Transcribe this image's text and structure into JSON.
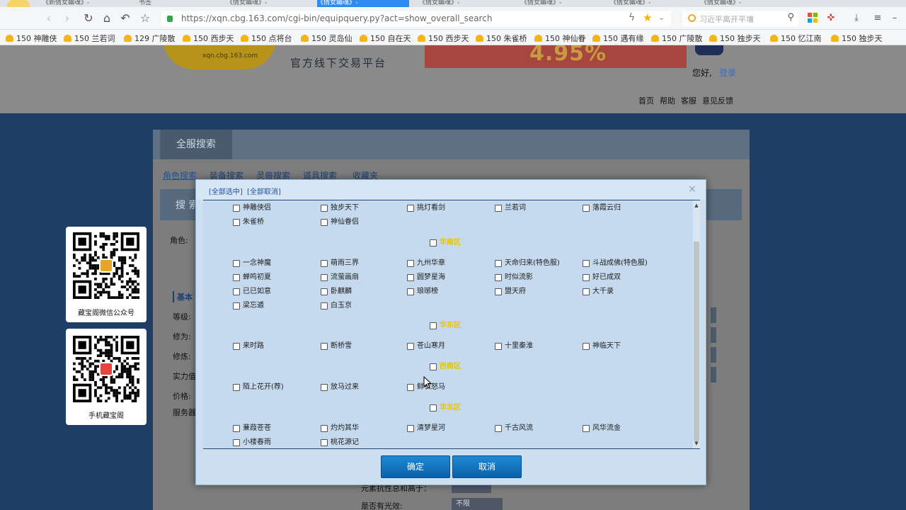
{
  "browser": {
    "tabs": [
      "《新倩女幽魂》-",
      "书签",
      "《倩女幽魂》-",
      "《倩女幽魂》-",
      "《倩女幽魂》-",
      "《倩女幽魂》-",
      "《倩女幽魂》-",
      "《倩女幽魂》-"
    ],
    "url": "https://xqn.cbg.163.com/cgi-bin/equipquery.py?act=show_overall_search",
    "search_placeholder": "习近平离开平壤",
    "bookmarks": [
      "150 神雕侠",
      "150 兰若词",
      "129 广陵散",
      "150 西步天",
      "150 点将台",
      "150 灵岛仙",
      "150 自在天",
      "150 西步天",
      "150 朱雀桥",
      "150 神仙眷",
      "150 遇有缘",
      "150 广陵散",
      "150 独步天",
      "150 忆江南",
      "150 独步天"
    ]
  },
  "header": {
    "logo_sub": "xqn.cbg.163.com",
    "tagline": "官方线下交易平台",
    "banner_text": "4.95%",
    "greeting": "您好,",
    "greeting_link": "登录",
    "menu": [
      "首页",
      "帮助",
      "客服",
      "意见反馈"
    ]
  },
  "panel": {
    "title": "全服搜索",
    "subtabs": [
      "角色搜索",
      "装备搜索",
      "灵兽搜索",
      "道具搜索",
      "收藏夹"
    ],
    "strip_label": "搜 索",
    "labels": [
      "角色:",
      "基本",
      "等级:",
      "修为:",
      "修炼:",
      "实力值:",
      "价格:",
      "服务器"
    ]
  },
  "under": {
    "label1": "元素抗性总和高于：",
    "label2": "是否有光效:",
    "select_value": "不限"
  },
  "qr": [
    {
      "caption": "藏宝阁微信公众号"
    },
    {
      "caption": "手机藏宝阁"
    }
  ],
  "modal": {
    "select_all": "[全部选中]",
    "deselect_all": "[全部取消]",
    "rows": [
      [
        "神雕侠侣",
        "独步天下",
        "挑灯看剑",
        "兰若词",
        "落霞云归"
      ],
      [
        "朱雀桥",
        "神仙眷侣"
      ],
      [
        "一念神魔",
        "萌雨三界",
        "九州华章",
        "天命归来(特色服)",
        "斗战成佛(特色服)"
      ],
      [
        "蝉鸣初夏",
        "流萤画扇",
        "圆梦星海",
        "时似流影",
        "好已成双"
      ],
      [
        "已已如意",
        "卧麒麟",
        "琅琊榜",
        "盟天府",
        "大千录"
      ],
      [
        "梁忘遁",
        "白玉京"
      ],
      [
        "来时路",
        "断桥雪",
        "苍山寒月",
        "十里秦淮",
        "神临天下"
      ],
      [
        "陌上花开(荐)",
        "放马过来",
        "鲜衣怒马"
      ],
      [
        "蒹葭苍苍",
        "灼灼其华",
        "清梦星河",
        "千古风流",
        "风华流金"
      ],
      [
        "小楼春雨",
        "桃花源记"
      ]
    ],
    "groups": [
      "华南区",
      "华东区",
      "西南区",
      "华北区"
    ],
    "confirm": "确定",
    "cancel": "取消"
  }
}
